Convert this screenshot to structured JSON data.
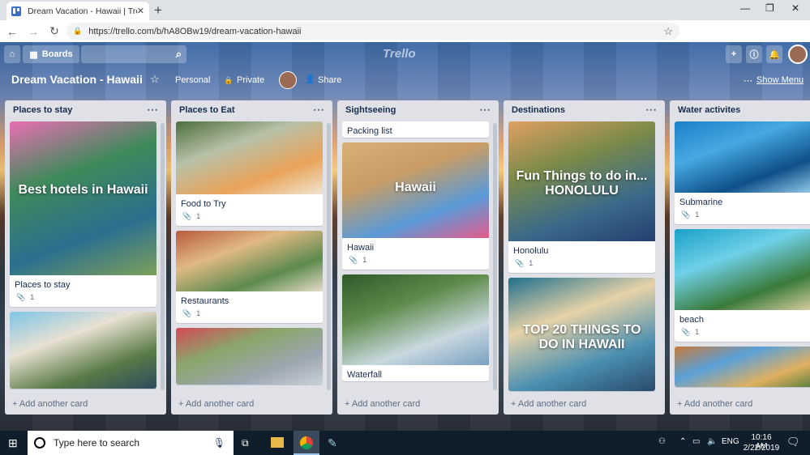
{
  "browser": {
    "tab_title": "Dream Vacation - Hawaii | Trello",
    "tab_close": "✕",
    "new_tab": "+",
    "url": "https://trello.com/b/hA8OBw19/dream-vacation-hawaii",
    "window_controls": [
      "—",
      "❐",
      "✕"
    ]
  },
  "trello": {
    "boards_label": "Boards",
    "logo": "Trello",
    "board_name": "Dream Vacation - Hawaii",
    "team": "Personal",
    "visibility": "Private",
    "share": "Share",
    "show_menu": "Show Menu"
  },
  "lists": [
    {
      "name": "Places to stay",
      "cards": [
        {
          "title": "Places to stay",
          "attachments": "1",
          "image_text": "Best hotels in Hawaii",
          "colors": [
            "#e96fb4",
            "#3f8a5a",
            "#2b6f8f",
            "#7da05a"
          ]
        },
        {
          "title": "",
          "attachments": "",
          "image_text": "",
          "colors": [
            "#7fc4e6",
            "#e8e1d3",
            "#5a7b47",
            "#2e4a5e"
          ]
        }
      ],
      "add": "+ Add another card"
    },
    {
      "name": "Places to Eat",
      "cards": [
        {
          "title": "Food to Try",
          "attachments": "1",
          "image_text": "",
          "colors": [
            "#4c6e3e",
            "#b8c1a8",
            "#e9a35a",
            "#f0e5d1"
          ]
        },
        {
          "title": "Restaurants",
          "attachments": "1",
          "image_text": "",
          "colors": [
            "#b85b3e",
            "#e0b985",
            "#5d8a4d",
            "#e6dcc8"
          ]
        },
        {
          "title": "",
          "attachments": "",
          "image_text": "",
          "colors": [
            "#d44a55",
            "#8aa66a",
            "#9ca6b0",
            "#c9d1da"
          ]
        }
      ],
      "add": "+ Add another card"
    },
    {
      "name": "Sightseeing",
      "cards": [
        {
          "title": "Packing list",
          "attachments": "",
          "image_text": "",
          "colors": []
        },
        {
          "title": "Hawaii",
          "attachments": "1",
          "image_text": "Hawaii",
          "colors": [
            "#d7b078",
            "#c99d65",
            "#5a9ad8",
            "#e65b8a"
          ]
        },
        {
          "title": "Waterfall",
          "attachments": "",
          "image_text": "",
          "colors": [
            "#2f5a2a",
            "#5f8a4a",
            "#c9d8e0",
            "#7aa0c0"
          ]
        }
      ],
      "add": "+ Add another card"
    },
    {
      "name": "Destinations",
      "cards": [
        {
          "title": "Honolulu",
          "attachments": "1",
          "image_text": "Fun Things to do in... HONOLULU",
          "colors": [
            "#e0a060",
            "#7a8a4a",
            "#3a6a8a",
            "#243f6e"
          ]
        },
        {
          "title": "",
          "attachments": "",
          "image_text": "TOP 20 THINGS TO DO IN HAWAII",
          "colors": [
            "#1f6f8c",
            "#e6d2a8",
            "#4a8fb0",
            "#2a4a6a"
          ]
        }
      ],
      "add": "+ Add another card"
    },
    {
      "name": "Water activites",
      "cards": [
        {
          "title": "Submarine",
          "attachments": "1",
          "image_text": "",
          "colors": [
            "#1b7fc8",
            "#46a9e0",
            "#0e4f8a",
            "#9fd6f0"
          ]
        },
        {
          "title": "beach",
          "attachments": "1",
          "image_text": "",
          "colors": [
            "#1aa0c8",
            "#6fd0e8",
            "#3a7a3a",
            "#e6d6a8"
          ]
        },
        {
          "title": "",
          "attachments": "",
          "image_text": "",
          "colors": [
            "#c87a3a",
            "#5aa0d8",
            "#e0b060",
            "#4a7a3a"
          ]
        }
      ],
      "add": "+ Add another card"
    }
  ],
  "taskbar": {
    "search_placeholder": "Type here to search",
    "lang": "ENG",
    "time": "10:16 AM",
    "date": "2/22/2019"
  },
  "colors": {
    "list_bg": "#dfe1e6",
    "card_bg": "#ffffff",
    "taskbar": "#101d2a",
    "chrome_accent": "#1a73e8"
  }
}
